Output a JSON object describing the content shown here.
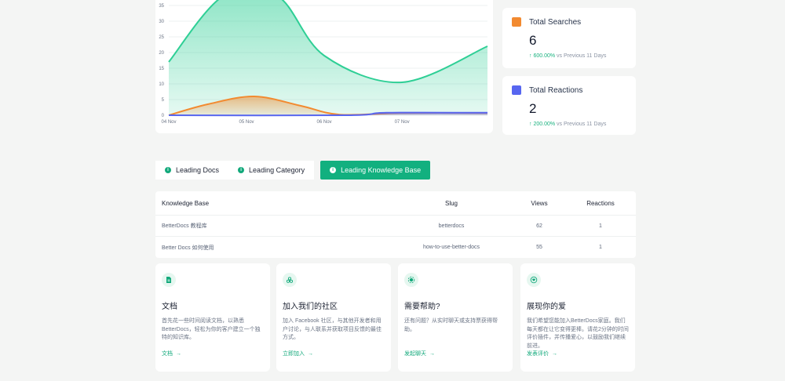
{
  "chart_data": {
    "type": "area",
    "x": [
      "04 Nov",
      "05 Nov",
      "06 Nov",
      "07 Nov"
    ],
    "x_ticks": [
      "04 Nov",
      "05 Nov",
      "06 Nov",
      "07 Nov"
    ],
    "y_ticks": [
      "0",
      "5",
      "10",
      "15",
      "20",
      "25",
      "30",
      "35"
    ],
    "ylim": [
      0,
      35
    ],
    "grid": true,
    "series": [
      {
        "color": "#2ecf95",
        "points": [
          [
            0,
            17
          ],
          [
            0.7,
            38
          ],
          [
            1.4,
            38
          ],
          [
            2,
            19
          ],
          [
            3,
            10.5
          ],
          [
            4.1,
            22
          ]
        ]
      },
      {
        "color": "#f28a30",
        "points": [
          [
            0,
            0
          ],
          [
            0.5,
            3.5
          ],
          [
            1.1,
            6
          ],
          [
            1.7,
            3
          ],
          [
            2.2,
            0.2
          ],
          [
            3,
            0.7
          ],
          [
            4.1,
            0.7
          ]
        ]
      },
      {
        "color": "#5766f0",
        "points": [
          [
            0,
            0
          ],
          [
            2.3,
            0
          ],
          [
            2.8,
            0.8
          ],
          [
            4.1,
            0.8
          ]
        ]
      }
    ]
  },
  "stats": {
    "searches": {
      "label": "Total Searches",
      "value": "6",
      "pct": "↑ 600.00%",
      "suffix": "vs Previous 11 Days",
      "color": "#f28a30"
    },
    "reactions": {
      "label": "Total Reactions",
      "value": "2",
      "pct": "↑ 200.00%",
      "suffix": "vs Previous 11 Days",
      "color": "#5766f0"
    }
  },
  "tabs": {
    "leading_docs": "Leading Docs",
    "leading_category": "Leading Category",
    "leading_kb": "Leading Knowledge Base"
  },
  "table": {
    "headers": {
      "name": "Knowledge Base",
      "slug": "Slug",
      "views": "Views",
      "reactions": "Reactions"
    },
    "rows": [
      {
        "name": "BetterDocs 教程库",
        "slug": "betterdocs",
        "views": "62",
        "reactions": "1"
      },
      {
        "name": "Better Docs 如何使用",
        "slug": "how-to-use-better-docs",
        "views": "55",
        "reactions": "1"
      }
    ]
  },
  "help": [
    {
      "title": "文档",
      "desc": "首先花一些时间阅读文档，以熟悉 BetterDocs，轻松为你的客户建立一个独特的知识库。",
      "link": "文档",
      "icon": "document-icon"
    },
    {
      "title": "加入我们的社区",
      "desc": "加入 Facebook 社区，与其他开发者和用户讨论，与人联系并获取项目反馈的最佳方式。",
      "link": "立即加入",
      "icon": "community-icon"
    },
    {
      "title": "需要帮助?",
      "desc": "还有问题？从实时聊天或支持票获得帮助。",
      "link": "发起聊天",
      "icon": "support-icon"
    },
    {
      "title": "展现你的爱",
      "desc": "我们希望您能加入BetterDocs家庭。我们每天都在让它变得更棒。请花2分钟的时间评价插件，并传播爱心，以鼓励我们继续前进。",
      "link": "发表评价",
      "icon": "love-icon"
    }
  ]
}
